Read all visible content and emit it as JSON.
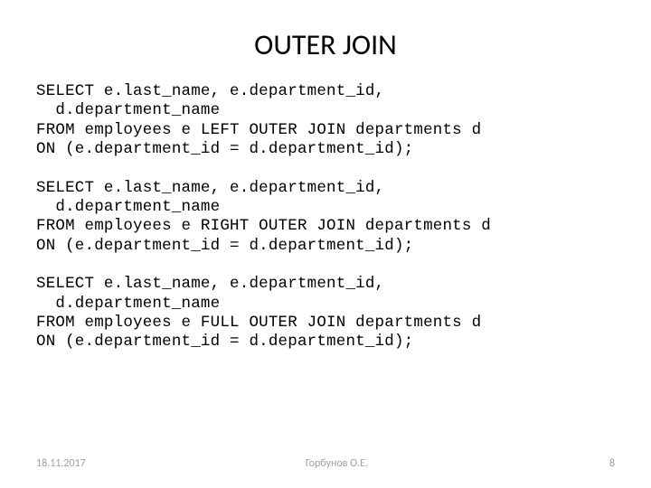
{
  "title": "OUTER JOIN",
  "code": "SELECT e.last_name, e.department_id,\n  d.department_name\nFROM employees e LEFT OUTER JOIN departments d\nON (e.department_id = d.department_id);\n\nSELECT e.last_name, e.department_id,\n  d.department_name\nFROM employees e RIGHT OUTER JOIN departments d\nON (e.department_id = d.department_id);\n\nSELECT e.last_name, e.department_id,\n  d.department_name\nFROM employees e FULL OUTER JOIN departments d\nON (e.department_id = d.department_id);",
  "footer": {
    "date": "18.11.2017",
    "author": "Горбунов О.Е.",
    "page": "8"
  }
}
